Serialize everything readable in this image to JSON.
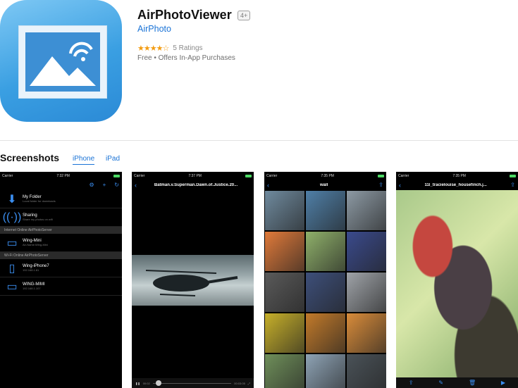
{
  "app": {
    "title": "AirPhotoViewer",
    "age_rating": "4+",
    "developer": "AirPhoto",
    "stars": "★★★★☆",
    "rating_value": 4,
    "ratings_count": "5 Ratings",
    "price_line": "Free • Offers In-App Purchases"
  },
  "screenshots_section": {
    "title": "Screenshots",
    "tabs": [
      {
        "label": "iPhone",
        "selected": true
      },
      {
        "label": "iPad",
        "selected": false
      }
    ]
  },
  "shots": [
    {
      "status_left": "Carrier",
      "status_time": "7:32 PM",
      "rows": [
        {
          "title": "My Folder",
          "subtitle": "Local folder for downloads",
          "icon": "download-folder-icon"
        },
        {
          "title": "Sharing",
          "subtitle": "Share my photos on wifi",
          "icon": "wifi-broadcast-icon"
        }
      ],
      "group_internet": "Internet Online AirPhotoServer",
      "internet_rows": [
        {
          "title": "Wing-Mini",
          "subtitle": "Air-Name:Wing-Mini",
          "icon": "monitor-icon"
        }
      ],
      "group_wifi": "Wi-Fi Online AirPhotoServer",
      "wifi_rows": [
        {
          "title": "Wing-iPhone7",
          "subtitle": "192.168.1.81",
          "icon": "phone-icon"
        },
        {
          "title": "WING-MIMI",
          "subtitle": "192.168.1.107",
          "icon": "monitor-icon"
        }
      ]
    },
    {
      "status_left": "Carrier",
      "status_time": "7:37 PM",
      "title": "Batman.v.Superman.Dawn.of.Justice.20...",
      "time_elapsed": "00:02",
      "time_total": "00:03:05"
    },
    {
      "status_left": "Carrier",
      "status_time": "7:35 PM",
      "title": "wall",
      "grid_colors": [
        "#6f8a9e",
        "#4f7fa7",
        "#8d9aa4",
        "#e07a3a",
        "#8fb06a",
        "#3a4a8c",
        "#5a5a5a",
        "#3d4f7a",
        "#9fa3a8",
        "#c7b02a",
        "#c27a2a",
        "#d98c3a",
        "#6f8f5a",
        "#8ea3b5",
        "#4a5258"
      ]
    },
    {
      "status_left": "Carrier",
      "status_time": "7:35 PM",
      "title": "11l_tracielouise_housefinch.j..."
    }
  ]
}
